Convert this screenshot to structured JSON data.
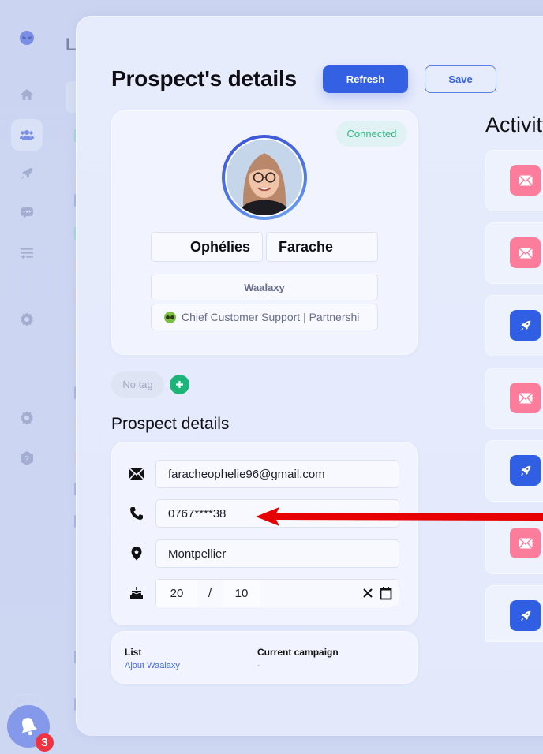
{
  "sidebar": {
    "items": [
      {
        "name": "logo",
        "icon": "alien-logo-icon"
      },
      {
        "name": "home",
        "icon": "home-icon"
      },
      {
        "name": "prospects",
        "icon": "users-icon",
        "active": true
      },
      {
        "name": "campaigns",
        "icon": "rocket-icon"
      },
      {
        "name": "inbox",
        "icon": "chat-icon"
      },
      {
        "name": "filters",
        "icon": "filter-list-icon"
      },
      {
        "name": "settings-top",
        "icon": "gear-icon"
      },
      {
        "name": "settings",
        "icon": "gear-icon"
      },
      {
        "name": "help",
        "icon": "help-icon"
      }
    ],
    "notifications": {
      "icon": "bell-icon",
      "count": "3"
    }
  },
  "background": {
    "heading_fragment": "L"
  },
  "modal": {
    "title": "Prospect's details",
    "refresh_label": "Refresh",
    "save_label": "Save",
    "profile": {
      "status": "Connected",
      "first_name": "Ophélies",
      "last_name": "Farache",
      "company": "Waalaxy",
      "job_title": "Chief Customer Support | Partnershi"
    },
    "tags": {
      "empty_label": "No tag",
      "add_label": "+"
    },
    "details_section_title": "Prospect details",
    "details": {
      "email": "faracheophelie96@gmail.com",
      "phone": "0767****38",
      "location": "Montpellier",
      "birthday_day": "20",
      "birthday_separator": "/",
      "birthday_month": "10"
    },
    "list": {
      "list_label": "List",
      "list_value": "Ajout Waalaxy",
      "campaign_label": "Current campaign",
      "campaign_value": "-"
    },
    "activity": {
      "title": "Activity",
      "items": [
        {
          "type": "mail"
        },
        {
          "type": "mail"
        },
        {
          "type": "rocket"
        },
        {
          "type": "mail"
        },
        {
          "type": "rocket"
        },
        {
          "type": "mail"
        },
        {
          "type": "rocket"
        }
      ]
    }
  },
  "colors": {
    "primary": "#3461e3",
    "connected": "#2db67d",
    "mail_icon_bg": "#fb7d9b",
    "rocket_icon_bg": "#315fe4",
    "annotation_arrow": "#e60000"
  }
}
